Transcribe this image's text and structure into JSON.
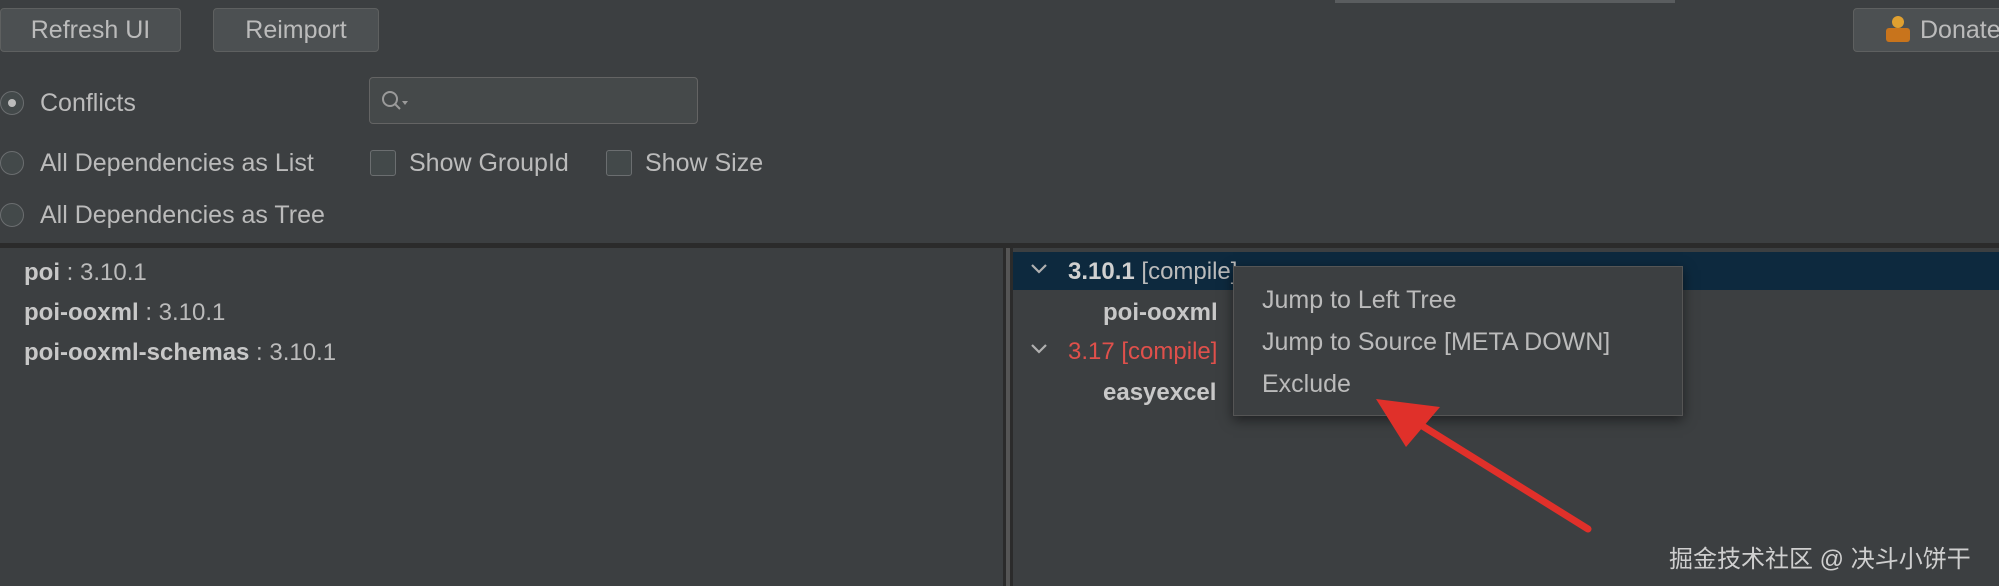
{
  "toolbar": {
    "refresh_label": "Refresh UI",
    "reimport_label": "Reimport",
    "donate_label": "Donate"
  },
  "filters": {
    "conflicts_label": "Conflicts",
    "all_list_label": "All Dependencies as List",
    "all_tree_label": "All Dependencies as Tree",
    "show_groupid_label": "Show GroupId",
    "show_size_label": "Show Size",
    "search_value": "",
    "selected": "Conflicts"
  },
  "left_tree": [
    {
      "name": "poi",
      "version": " : 3.10.1"
    },
    {
      "name": "poi-ooxml",
      "version": " : 3.10.1"
    },
    {
      "name": "poi-ooxml-schemas",
      "version": " : 3.10.1"
    }
  ],
  "right_tree": {
    "row1_version": "3.10.1",
    "row1_scope": " [compile]",
    "row2_name": "poi-ooxml",
    "row3_version": "3.17 [compile]",
    "row4_name": "easyexcel"
  },
  "context_menu": {
    "items": [
      "Jump to Left Tree",
      "Jump to Source [META DOWN]",
      "Exclude"
    ]
  },
  "watermark": "掘金技术社区 @ 决斗小饼干",
  "colors": {
    "background": "#3c3f41",
    "selection": "#0d293e",
    "conflict_red": "#e0504b",
    "arrow_red": "#e0302a"
  }
}
